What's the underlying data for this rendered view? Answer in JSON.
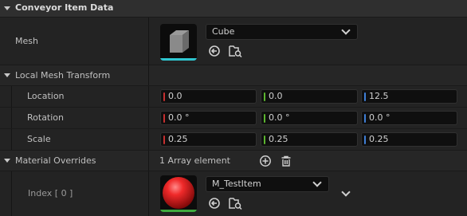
{
  "colors": {
    "x_axis": "#c73030",
    "y_axis": "#5cb52f",
    "z_axis": "#3f7fd6",
    "mesh_underline": "#2fc6d0",
    "material_underline": "#3faa3f"
  },
  "sections": {
    "conveyor_item_data": "Conveyor Item Data",
    "local_mesh_transform": "Local Mesh Transform",
    "material_overrides": "Material Overrides"
  },
  "mesh": {
    "label": "Mesh",
    "value": "Cube"
  },
  "transform": {
    "location": {
      "label": "Location",
      "x": "0.0",
      "y": "0.0",
      "z": "12.5"
    },
    "rotation": {
      "label": "Rotation",
      "x": "0.0 °",
      "y": "0.0 °",
      "z": "0.0 °"
    },
    "scale": {
      "label": "Scale",
      "x": "0.25",
      "y": "0.25",
      "z": "0.25"
    }
  },
  "material_overrides": {
    "count_text": "1 Array element",
    "index_label": "Index [ 0 ]",
    "value": "M_TestItem"
  },
  "icons": [
    "collapse-arrow-icon",
    "chevron-down-icon",
    "use-selected-icon",
    "browse-icon",
    "add-icon",
    "trash-icon"
  ]
}
